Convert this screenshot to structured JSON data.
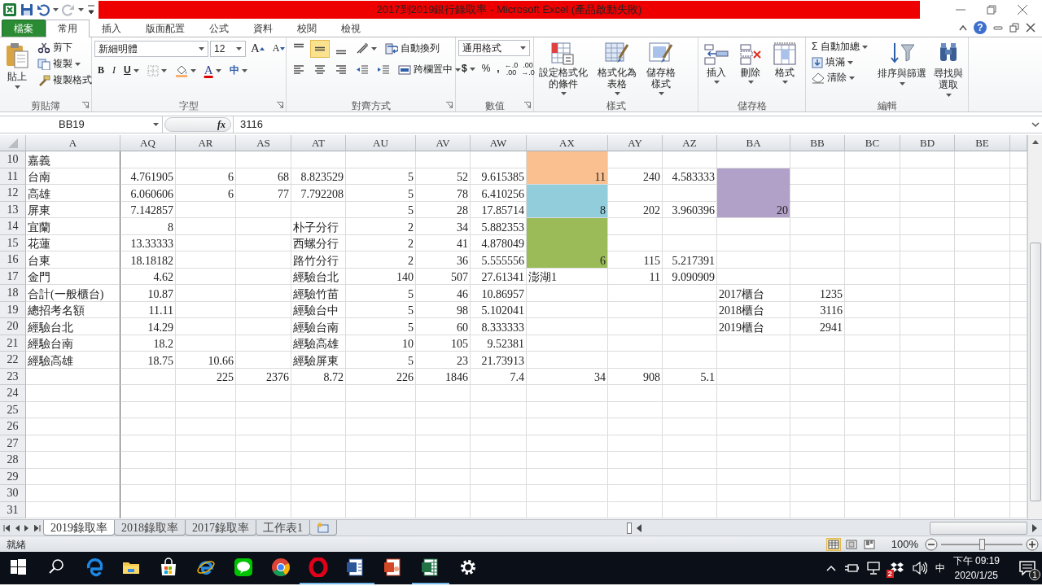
{
  "window": {
    "title": "2017到2019銀行錄取率 - Microsoft Excel (產品啟動失敗)",
    "help": "?"
  },
  "ribbon": {
    "tabs": [
      {
        "label": "檔案",
        "kind": "file",
        "selected": false
      },
      {
        "label": "常用",
        "kind": "tab",
        "selected": true
      },
      {
        "label": "插入",
        "kind": "tab",
        "selected": false
      },
      {
        "label": "版面配置",
        "kind": "tab",
        "selected": false
      },
      {
        "label": "公式",
        "kind": "tab",
        "selected": false
      },
      {
        "label": "資料",
        "kind": "tab",
        "selected": false
      },
      {
        "label": "校閱",
        "kind": "tab",
        "selected": false
      },
      {
        "label": "檢視",
        "kind": "tab",
        "selected": false
      }
    ],
    "clipboard": {
      "label": "剪貼簿",
      "paste": "貼上",
      "cut": "剪下",
      "copy": "複製",
      "format_painter": "複製格式"
    },
    "font": {
      "label": "字型",
      "font_name": "新細明體",
      "font_size": "12",
      "grow": "A",
      "shrink": "A",
      "bold": "B",
      "italic": "I",
      "underline": "U",
      "font_color": "A",
      "phonetic": "中"
    },
    "alignment": {
      "label": "對齊方式",
      "vertical_align": [
        {
          "selected": false
        },
        {
          "selected": true
        },
        {
          "selected": false
        }
      ],
      "wrap_text": "自動換列",
      "merge_center": "跨欄置中"
    },
    "number": {
      "label": "數值",
      "format": "通用格式",
      "currency": "$",
      "percent": "%",
      "comma": ",",
      "increase_decimal": [
        "←.0",
        ".00"
      ],
      "decrease_decimal": [
        ".00",
        "→.0"
      ]
    },
    "styles": {
      "label": "樣式",
      "buttons": [
        {
          "lines": [
            "設定格式化",
            "的條件"
          ],
          "kind": "conditional"
        },
        {
          "lines": [
            "格式化為",
            "表格"
          ],
          "kind": "table"
        },
        {
          "lines": [
            "儲存格",
            "樣式"
          ],
          "kind": "cellstyle"
        }
      ]
    },
    "cells": {
      "label": "儲存格",
      "buttons": [
        {
          "lines": [
            "插入"
          ],
          "kind": "insert"
        },
        {
          "lines": [
            "刪除"
          ],
          "kind": "delete"
        },
        {
          "lines": [
            "格式"
          ],
          "kind": "format"
        }
      ]
    },
    "editing": {
      "label": "編輯",
      "autosum_symbol": "Σ",
      "autosum": "自動加總",
      "fill": "填滿",
      "clear": "清除",
      "sort": [
        "排序與篩選"
      ],
      "find": [
        "尋找與",
        "選取"
      ]
    }
  },
  "formula_bar": {
    "name_box": "BB19",
    "function_symbol": "fx",
    "content": "3116"
  },
  "sheet": {
    "columns": [
      "A",
      "AQ",
      "AR",
      "AS",
      "AT",
      "AU",
      "AV",
      "AW",
      "AX",
      "AY",
      "AZ",
      "BA",
      "BB",
      "BC",
      "BD",
      "BE"
    ],
    "rows": [
      {
        "number": "10",
        "cells": [
          {
            "text": "嘉義",
            "kind": "label"
          },
          null,
          null,
          null,
          null,
          null,
          null,
          null,
          {
            "color": "#fac090",
            "merge_down": true
          }
        ]
      },
      {
        "number": "11",
        "cells": [
          {
            "text": "台南",
            "kind": "label"
          },
          "4.761905",
          "6",
          "68",
          "8.823529",
          "5",
          "52",
          "9.615385",
          {
            "text": "11",
            "color": "#fac090"
          },
          "240",
          "4.583333",
          {
            "color": "#b1a0c7",
            "merge_down": true
          }
        ]
      },
      {
        "number": "12",
        "cells": [
          {
            "text": "高雄",
            "kind": "label"
          },
          "6.060606",
          "6",
          "77",
          "7.792208",
          "5",
          "78",
          "6.410256",
          {
            "color": "#92cddc",
            "merge_down": true
          },
          null,
          null,
          {
            "color": "#b1a0c7",
            "merge_down": true
          }
        ]
      },
      {
        "number": "13",
        "cells": [
          {
            "text": "屏東",
            "kind": "label"
          },
          "7.142857",
          null,
          null,
          null,
          "5",
          "28",
          "17.85714",
          {
            "text": "8",
            "color": "#92cddc"
          },
          "202",
          "3.960396",
          {
            "text": "20",
            "color": "#b1a0c7"
          }
        ]
      },
      {
        "number": "14",
        "cells": [
          {
            "text": "宜蘭",
            "kind": "label"
          },
          "8",
          null,
          null,
          {
            "text": "朴子分行",
            "kind": "label"
          },
          "2",
          "34",
          "5.882353",
          {
            "color": "#9bbb59",
            "merge_down": true
          }
        ]
      },
      {
        "number": "15",
        "cells": [
          {
            "text": "花蓮",
            "kind": "label"
          },
          "13.33333",
          null,
          null,
          {
            "text": "西螺分行",
            "kind": "label"
          },
          "2",
          "41",
          "4.878049",
          {
            "color": "#9bbb59",
            "merge_down": true
          }
        ]
      },
      {
        "number": "16",
        "cells": [
          {
            "text": "台東",
            "kind": "label"
          },
          "18.18182",
          null,
          null,
          {
            "text": "路竹分行",
            "kind": "label"
          },
          "2",
          "36",
          "5.555556",
          {
            "text": "6",
            "color": "#9bbb59"
          },
          "115",
          "5.217391"
        ]
      },
      {
        "number": "17",
        "cells": [
          {
            "text": "金門",
            "kind": "label"
          },
          "4.62",
          null,
          null,
          {
            "text": "經驗台北",
            "kind": "label"
          },
          "140",
          "507",
          "27.61341",
          {
            "text": "澎湖1",
            "kind": "label"
          },
          "11",
          "9.090909"
        ]
      },
      {
        "number": "18",
        "cells": [
          {
            "text": "合計(一般櫃台)",
            "kind": "label"
          },
          "10.87",
          null,
          null,
          {
            "text": "經驗竹苗",
            "kind": "label"
          },
          "5",
          "46",
          "10.86957",
          null,
          null,
          null,
          {
            "text": "2017櫃台",
            "kind": "label"
          },
          "1235"
        ]
      },
      {
        "number": "19",
        "cells": [
          {
            "text": "總招考名額",
            "kind": "label"
          },
          "11.11",
          null,
          null,
          {
            "text": "經驗台中",
            "kind": "label"
          },
          "5",
          "98",
          "5.102041",
          null,
          null,
          null,
          {
            "text": "2018櫃台",
            "kind": "label"
          },
          "3116"
        ]
      },
      {
        "number": "20",
        "cells": [
          {
            "text": "經驗台北",
            "kind": "label"
          },
          "14.29",
          null,
          null,
          {
            "text": "經驗台南",
            "kind": "label"
          },
          "5",
          "60",
          "8.333333",
          null,
          null,
          null,
          {
            "text": "2019櫃台",
            "kind": "label"
          },
          "2941"
        ]
      },
      {
        "number": "21",
        "cells": [
          {
            "text": "經驗台南",
            "kind": "label"
          },
          "18.2",
          null,
          null,
          {
            "text": "經驗高雄",
            "kind": "label"
          },
          "10",
          "105",
          "9.52381"
        ]
      },
      {
        "number": "22",
        "cells": [
          {
            "text": "經驗高雄",
            "kind": "label"
          },
          "18.75",
          "10.66",
          null,
          {
            "text": "經驗屏東",
            "kind": "label"
          },
          "5",
          "23",
          "21.73913"
        ]
      },
      {
        "number": "23",
        "cells": [
          null,
          null,
          "225",
          "2376",
          "8.72",
          "226",
          "1846",
          "7.4",
          "34",
          "908",
          "5.1"
        ]
      },
      {
        "number": "24"
      },
      {
        "number": "25"
      },
      {
        "number": "26"
      },
      {
        "number": "27"
      },
      {
        "number": "28"
      },
      {
        "number": "29"
      },
      {
        "number": "30"
      },
      {
        "number": "31"
      }
    ]
  },
  "sheet_tabs": [
    {
      "label": "2019錄取率",
      "selected": true
    },
    {
      "label": "2018錄取率",
      "selected": false
    },
    {
      "label": "2017錄取率",
      "selected": false
    },
    {
      "label": "工作表1",
      "selected": false
    }
  ],
  "status_bar": {
    "status": "就緒",
    "views": [
      {
        "selected": true
      },
      {
        "selected": false
      },
      {
        "selected": false
      }
    ],
    "zoom": "100%",
    "zoom_slider": {
      "level": 0.5
    }
  },
  "taskbar": {
    "apps": [
      {
        "kind": "start",
        "running": false
      },
      {
        "kind": "search",
        "running": false
      },
      {
        "kind": "edge",
        "running": false
      },
      {
        "kind": "folder",
        "running": false
      },
      {
        "kind": "store",
        "running": false
      },
      {
        "kind": "ie",
        "running": false
      },
      {
        "kind": "chat",
        "running": false
      },
      {
        "kind": "chrome",
        "running": false
      },
      {
        "kind": "opera",
        "running": true
      },
      {
        "kind": "word",
        "running": true
      },
      {
        "kind": "slides",
        "running": false
      },
      {
        "kind": "excel",
        "running": true
      },
      {
        "kind": "gear",
        "running": false
      }
    ],
    "tray": {
      "ime": "中",
      "box_badge": "2",
      "time": "下午 09:19",
      "date": "2020/1/25",
      "notifications": "1"
    }
  }
}
